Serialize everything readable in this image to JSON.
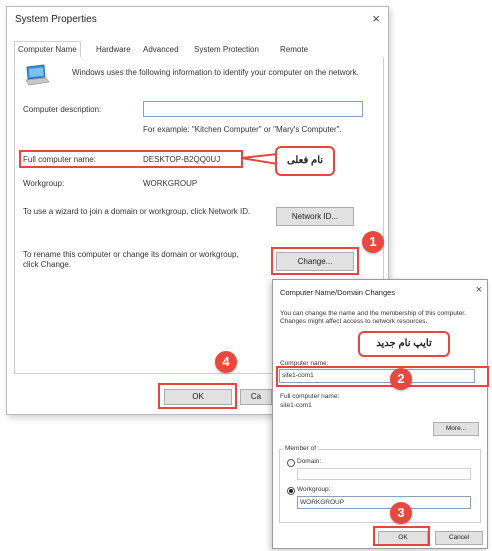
{
  "system_properties": {
    "title": "System Properties",
    "close_glyph": "×",
    "tabs": [
      "Computer Name",
      "Hardware",
      "Advanced",
      "System Protection",
      "Remote"
    ],
    "intro_text": "Windows uses the following information to identify your computer on the network.",
    "computer_description_label": "Computer description:",
    "computer_description_value": "",
    "example_text": "For example: \"Kitchen Computer\" or \"Mary's Computer\".",
    "full_name_label": "Full computer name:",
    "full_name_value": "DESKTOP-B2QQ0UJ",
    "workgroup_label": "Workgroup:",
    "workgroup_value": "WORKGROUP",
    "network_id_text": "To use a wizard to join a domain or workgroup, click Network ID.",
    "network_id_button": "Network ID...",
    "rename_text": "To rename this computer or change its domain or workgroup, click Change.",
    "change_button": "Change...",
    "ok_button": "OK",
    "cancel_button": "Ca"
  },
  "annotations": {
    "current_name_callout": "نام فعلی",
    "type_new_name_callout": "تایپ نام جدید",
    "step1": "1",
    "step2": "2",
    "step3": "3",
    "step4": "4",
    "accent_color": "#e5473f"
  },
  "changes_dialog": {
    "title": "Computer Name/Domain Changes",
    "close_glyph": "×",
    "intro_text": "You can change the name and the membership of this computer. Changes might affect access to network resources.",
    "computer_name_label": "Computer name:",
    "computer_name_value": "site1-com1",
    "full_name_label": "Full computer name:",
    "full_name_value": "site1-com1",
    "more_button": "More...",
    "member_of_label": "Member of",
    "domain_option": "Domain:",
    "workgroup_option": "Workgroup:",
    "workgroup_value": "WORKGROUP",
    "ok_button": "OK",
    "cancel_button": "Cancel"
  }
}
